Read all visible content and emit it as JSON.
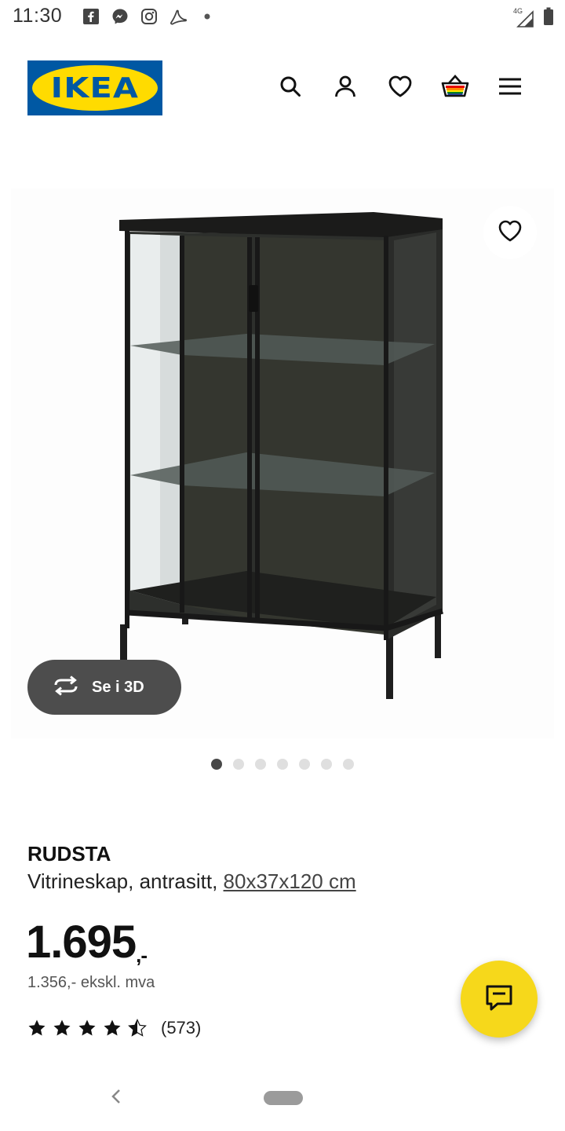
{
  "status_bar": {
    "time": "11:30",
    "left_icons": [
      "facebook-icon",
      "messenger-icon",
      "instagram-icon",
      "acrobat-icon",
      "notification-dot-icon"
    ],
    "network_label": "4G",
    "right_icons": [
      "signal-icon",
      "battery-icon"
    ]
  },
  "header": {
    "logo_text": "IKEA",
    "actions": [
      "search-icon",
      "account-icon",
      "favorites-icon",
      "cart-icon",
      "menu-icon"
    ]
  },
  "product_image": {
    "alt": "RUDSTA vitrineskap",
    "view_3d_label": "Se i 3D",
    "carousel_total": 7,
    "carousel_active_index": 0
  },
  "product": {
    "name": "RUDSTA",
    "description": "Vitrineskap, antrasitt,",
    "size": "80x37x120 cm",
    "price": "1.695",
    "price_suffix": ",-",
    "price_ex_vat": "1.356,- ekskl. mva",
    "rating": 4.5,
    "rating_max": 5,
    "review_count": "(573)"
  },
  "colors": {
    "ikea_blue": "#0058a3",
    "ikea_yellow": "#ffdb00",
    "chat_fab": "#f6d81b",
    "button_dark": "#4d4d4d"
  }
}
